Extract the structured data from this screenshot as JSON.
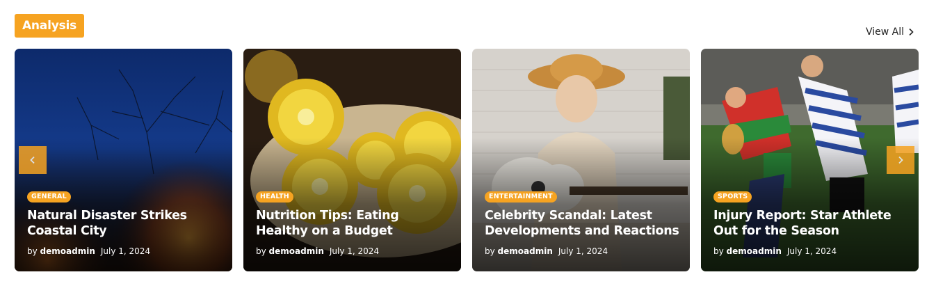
{
  "section": {
    "title": "Analysis",
    "view_all_label": "View All"
  },
  "colors": {
    "accent": "#f6a321"
  },
  "cards": [
    {
      "category": "GENERAL",
      "title": "Natural Disaster Strikes Coastal City",
      "by": "by",
      "author": "demoadmin",
      "date": "July 1, 2024",
      "image": "night wildfire with bare trees"
    },
    {
      "category": "HEALTH",
      "title": "Nutrition Tips: Eating Healthy on a Budget",
      "by": "by",
      "author": "demoadmin",
      "date": "July 1, 2024",
      "image": "sliced golden kiwi fruit"
    },
    {
      "category": "ENTERTAINMENT",
      "title": "Celebrity Scandal: Latest Developments and Reactions",
      "by": "by",
      "author": "demoadmin",
      "date": "July 1, 2024",
      "image": "woman in hat playing guitar"
    },
    {
      "category": "SPORTS",
      "title": "Injury Report: Star Athlete Out for the Season",
      "by": "by",
      "author": "demoadmin",
      "date": "July 1, 2024",
      "image": "rugby players tackling"
    }
  ],
  "nav": {
    "prev_icon": "chevron-left-icon",
    "next_icon": "chevron-right-icon"
  }
}
